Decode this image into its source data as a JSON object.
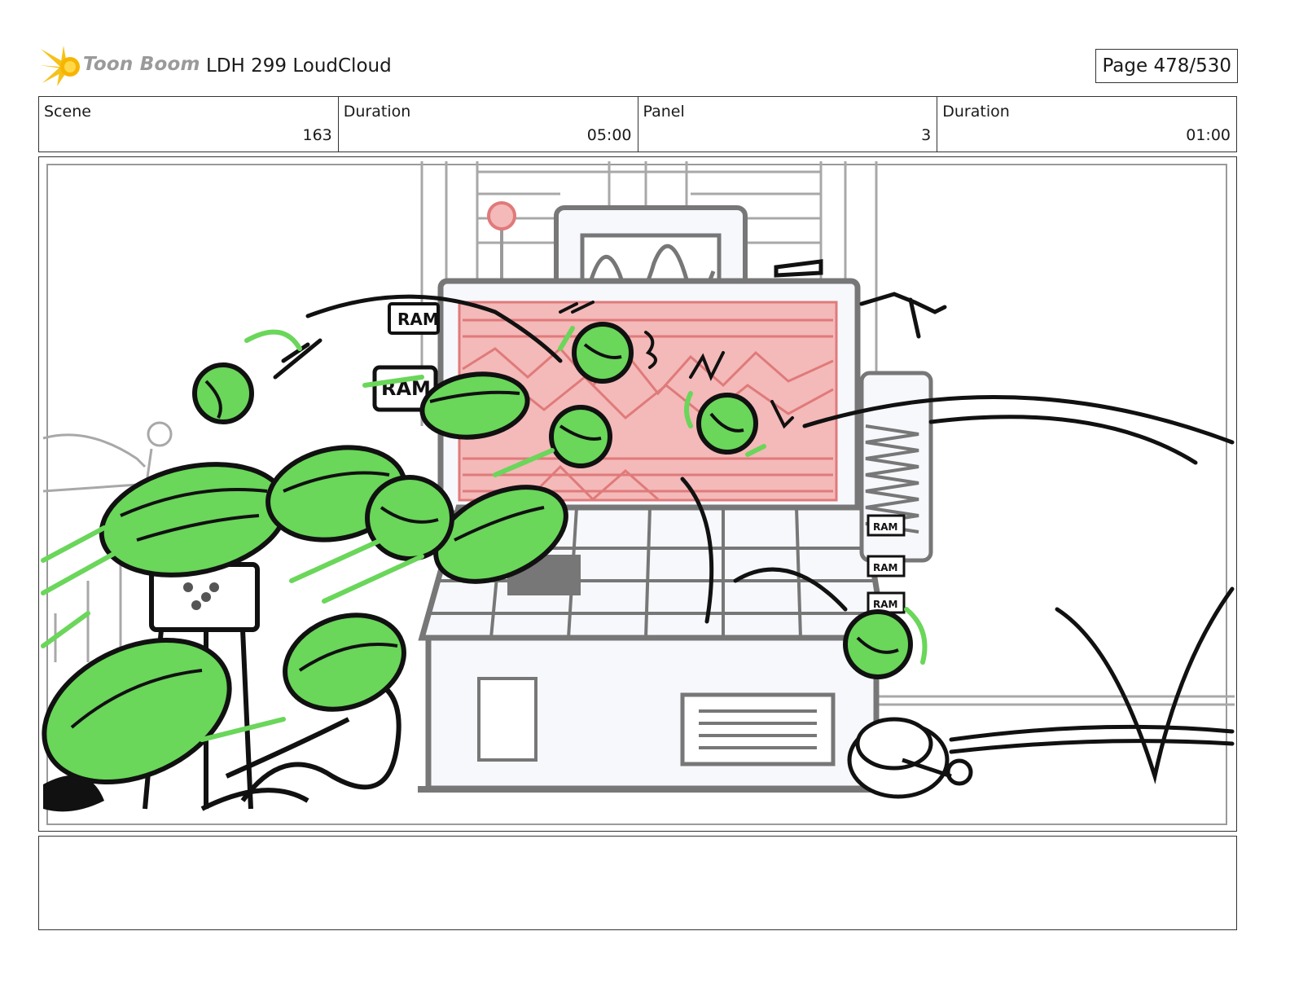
{
  "header": {
    "logo_text": "Toon Boom",
    "project_title": "LDH 299 LoudCloud",
    "page_label": "Page 478/530"
  },
  "info": {
    "scene_label": "Scene",
    "scene_value": "163",
    "scene_duration_label": "Duration",
    "scene_duration_value": "05:00",
    "panel_label": "Panel",
    "panel_value": "3",
    "panel_duration_label": "Duration",
    "panel_duration_value": "01:00"
  },
  "drawing": {
    "ram_labels": [
      "RAM",
      "RAM",
      "RAM",
      "RAM",
      "RAM"
    ],
    "colors": {
      "ball_green": "#6ad65a",
      "screen_pink": "#f4b9b9",
      "line_black": "#111111",
      "sketch_gray": "#9a9a9a"
    }
  },
  "notes": {
    "text": ""
  }
}
